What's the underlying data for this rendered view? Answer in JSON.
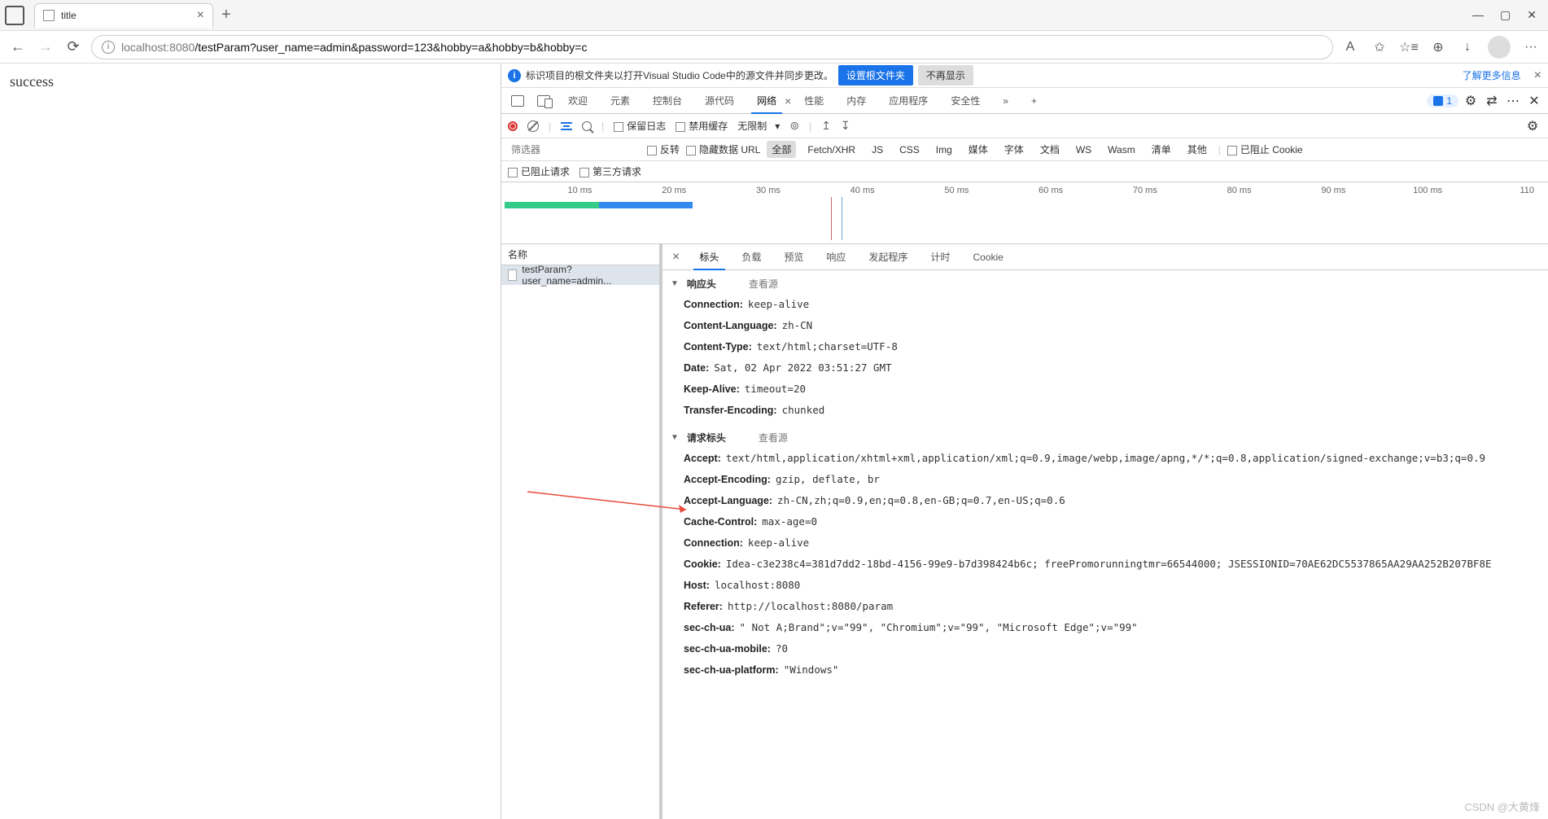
{
  "browser": {
    "tab_title": "title",
    "url_host": "localhost",
    "url_port": ":8080",
    "url_path": "/testParam?user_name=admin&password=123&hobby=a&hobby=b&hobby=c",
    "reader_label": "A",
    "more_label": "···"
  },
  "page": {
    "body_text": "success"
  },
  "banner": {
    "message": "标识项目的根文件夹以打开Visual Studio Code中的源文件并同步更改。",
    "btn_set": "设置根文件夹",
    "btn_dismiss": "不再显示",
    "link_more": "了解更多信息"
  },
  "tabs": {
    "items": [
      "欢迎",
      "元素",
      "控制台",
      "源代码",
      "网络",
      "性能",
      "内存",
      "应用程序",
      "安全性"
    ],
    "more": "»",
    "issues_count": "1"
  },
  "toolbar": {
    "preserve_log": "保留日志",
    "disable_cache": "禁用缓存",
    "throttle": "无限制"
  },
  "filterbar": {
    "placeholder": "筛选器",
    "invert": "反转",
    "hide_data_urls": "隐藏数据 URL",
    "types": [
      "全部",
      "Fetch/XHR",
      "JS",
      "CSS",
      "Img",
      "媒体",
      "字体",
      "文档",
      "WS",
      "Wasm",
      "清单",
      "其他"
    ],
    "blocked_cookies": "已阻止 Cookie"
  },
  "filterbar2": {
    "blocked_requests": "已阻止请求",
    "third_party": "第三方请求"
  },
  "timeline": {
    "ticks": [
      "10 ms",
      "20 ms",
      "30 ms",
      "40 ms",
      "50 ms",
      "60 ms",
      "70 ms",
      "80 ms",
      "90 ms",
      "100 ms",
      "110"
    ]
  },
  "requests": {
    "name_header": "名称",
    "rows": [
      "testParam?user_name=admin..."
    ]
  },
  "detail_tabs": [
    "标头",
    "负载",
    "预览",
    "响应",
    "发起程序",
    "计时",
    "Cookie"
  ],
  "headers": {
    "response_section": "响应头",
    "request_section": "请求标头",
    "view_source": "查看源",
    "response": [
      {
        "k": "Connection:",
        "v": "keep-alive"
      },
      {
        "k": "Content-Language:",
        "v": "zh-CN"
      },
      {
        "k": "Content-Type:",
        "v": "text/html;charset=UTF-8"
      },
      {
        "k": "Date:",
        "v": "Sat, 02 Apr 2022 03:51:27 GMT"
      },
      {
        "k": "Keep-Alive:",
        "v": "timeout=20"
      },
      {
        "k": "Transfer-Encoding:",
        "v": "chunked"
      }
    ],
    "request": [
      {
        "k": "Accept:",
        "v": "text/html,application/xhtml+xml,application/xml;q=0.9,image/webp,image/apng,*/*;q=0.8,application/signed-exchange;v=b3;q=0.9"
      },
      {
        "k": "Accept-Encoding:",
        "v": "gzip, deflate, br"
      },
      {
        "k": "Accept-Language:",
        "v": "zh-CN,zh;q=0.9,en;q=0.8,en-GB;q=0.7,en-US;q=0.6"
      },
      {
        "k": "Cache-Control:",
        "v": "max-age=0"
      },
      {
        "k": "Connection:",
        "v": "keep-alive"
      },
      {
        "k": "Cookie:",
        "v": "Idea-c3e238c4=381d7dd2-18bd-4156-99e9-b7d398424b6c; freePromorunningtmr=66544000; JSESSIONID=70AE62DC5537865AA29AA252B207BF8E"
      },
      {
        "k": "Host:",
        "v": "localhost:8080"
      },
      {
        "k": "Referer:",
        "v": "http://localhost:8080/param"
      },
      {
        "k": "sec-ch-ua:",
        "v": "\" Not A;Brand\";v=\"99\", \"Chromium\";v=\"99\", \"Microsoft Edge\";v=\"99\""
      },
      {
        "k": "sec-ch-ua-mobile:",
        "v": "?0"
      },
      {
        "k": "sec-ch-ua-platform:",
        "v": "\"Windows\""
      }
    ]
  },
  "watermark": "CSDN @大黄烽"
}
